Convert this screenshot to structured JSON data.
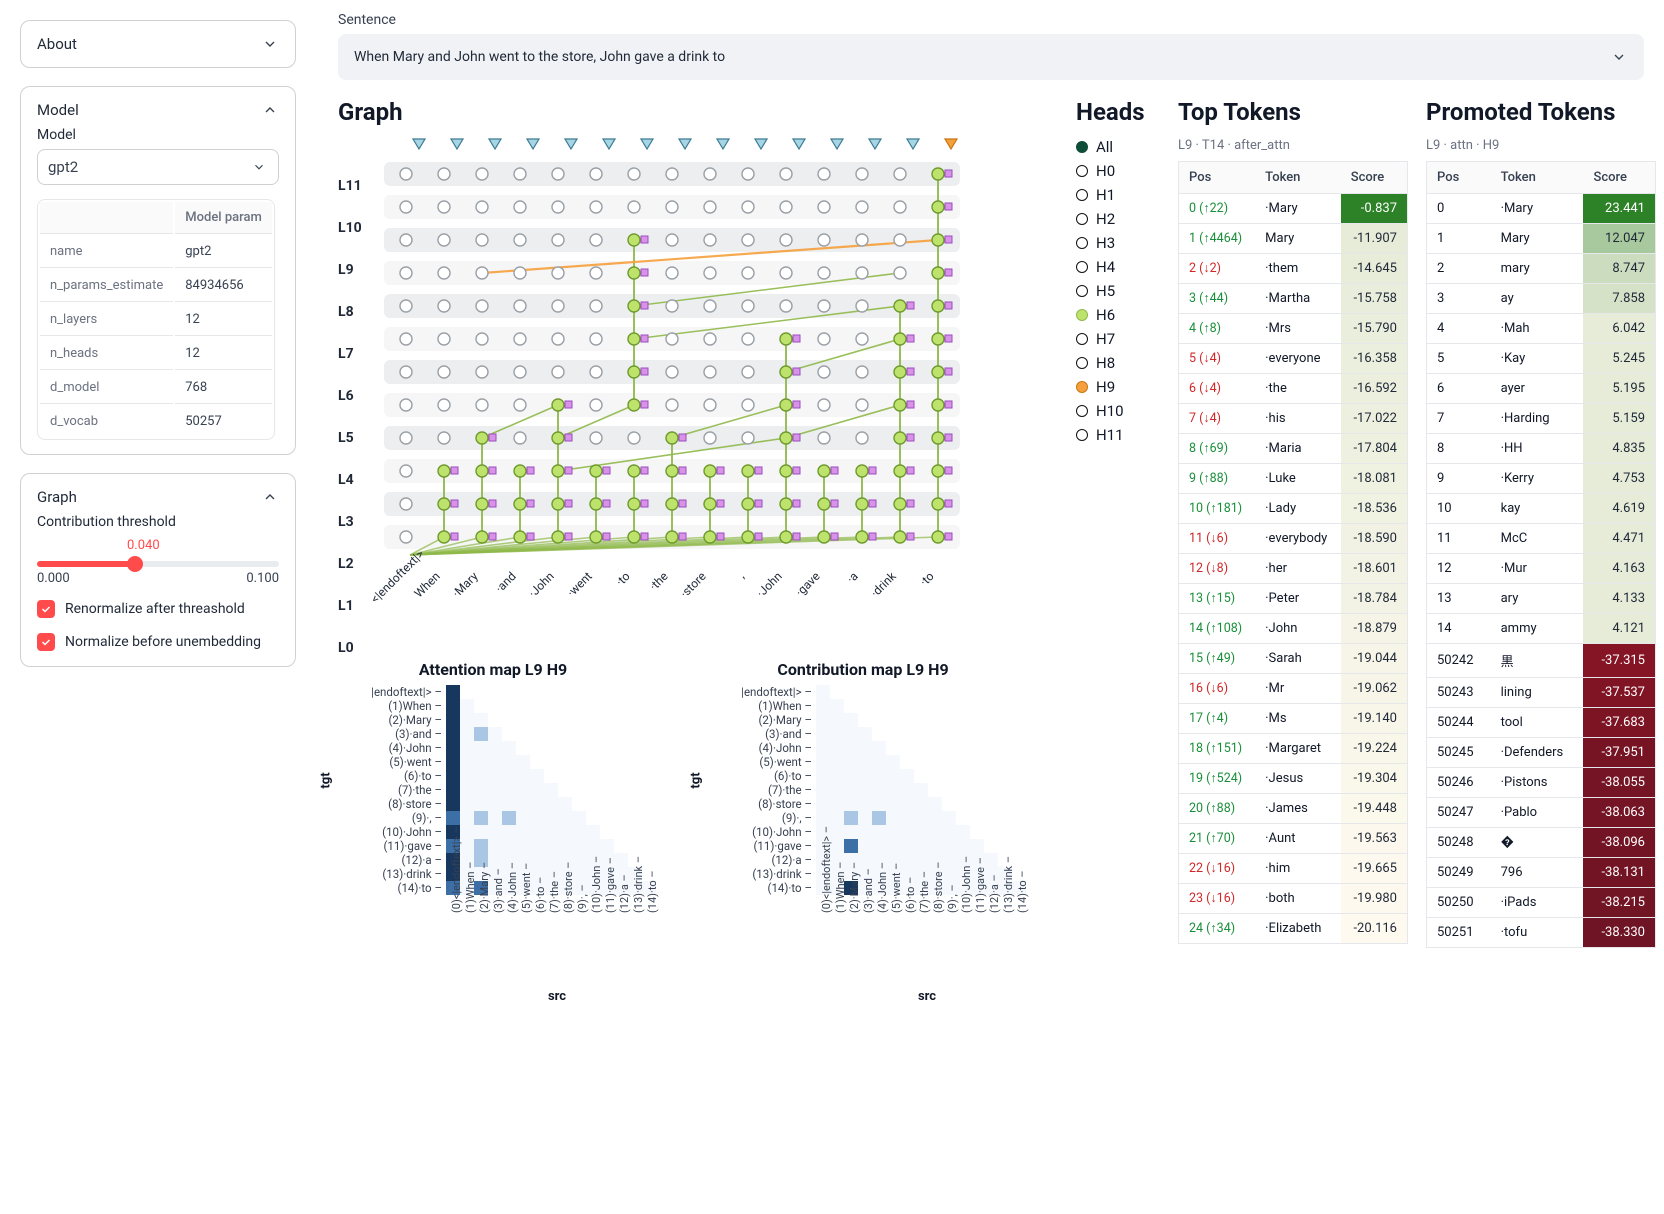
{
  "sidebar": {
    "about": {
      "title": "About",
      "expanded": false
    },
    "model_card": {
      "title": "Model",
      "label": "Model",
      "selected": "gpt2",
      "params_header_blank": "",
      "params_header_value": "Model param",
      "params": [
        {
          "name": "name",
          "value": "gpt2"
        },
        {
          "name": "n_params_estimate",
          "value": "84934656"
        },
        {
          "name": "n_layers",
          "value": "12"
        },
        {
          "name": "n_heads",
          "value": "12"
        },
        {
          "name": "d_model",
          "value": "768"
        },
        {
          "name": "d_vocab",
          "value": "50257"
        }
      ]
    },
    "graph_card": {
      "title": "Graph",
      "threshold_label": "Contribution threshold",
      "threshold_value": "0.040",
      "threshold_min": "0.000",
      "threshold_max": "0.100",
      "cb1": "Renormalize after threashold",
      "cb2": "Normalize before unembedding"
    }
  },
  "sentence": {
    "label": "Sentence",
    "text": "When Mary and John went to the store, John gave a drink to"
  },
  "graph": {
    "title": "Graph",
    "layers": [
      "L11",
      "L10",
      "L9",
      "L8",
      "L7",
      "L6",
      "L5",
      "L4",
      "L3",
      "L2",
      "L1",
      "L0"
    ],
    "tokens": [
      "<|endoftext|>",
      "When",
      "·Mary",
      "·and",
      "·John",
      "·went",
      "·to",
      "·the",
      "·store",
      ",",
      "·John",
      "·gave",
      "·a",
      "·drink",
      "·to"
    ]
  },
  "heads": {
    "title": "Heads",
    "items": [
      "All",
      "H0",
      "H1",
      "H2",
      "H3",
      "H4",
      "H5",
      "H6",
      "H7",
      "H8",
      "H9",
      "H10",
      "H11"
    ]
  },
  "top_tokens": {
    "title": "Top Tokens",
    "subtitle": "L9 · T14 · after_attn",
    "cols": {
      "pos": "Pos",
      "token": "Token",
      "score": "Score"
    },
    "rows": [
      {
        "pos": "0",
        "delta": "↑22",
        "dir": "up",
        "token": "·Mary",
        "score": "-0.837"
      },
      {
        "pos": "1",
        "delta": "↑4464",
        "dir": "up",
        "token": "Mary",
        "score": "-11.907"
      },
      {
        "pos": "2",
        "delta": "↓2",
        "dir": "dn",
        "token": "·them",
        "score": "-14.645"
      },
      {
        "pos": "3",
        "delta": "↑44",
        "dir": "up",
        "token": "·Martha",
        "score": "-15.758"
      },
      {
        "pos": "4",
        "delta": "↑8",
        "dir": "up",
        "token": "·Mrs",
        "score": "-15.790"
      },
      {
        "pos": "5",
        "delta": "↓4",
        "dir": "dn",
        "token": "·everyone",
        "score": "-16.358"
      },
      {
        "pos": "6",
        "delta": "↓4",
        "dir": "dn",
        "token": "·the",
        "score": "-16.592"
      },
      {
        "pos": "7",
        "delta": "↓4",
        "dir": "dn",
        "token": "·his",
        "score": "-17.022"
      },
      {
        "pos": "8",
        "delta": "↑69",
        "dir": "up",
        "token": "·Maria",
        "score": "-17.804"
      },
      {
        "pos": "9",
        "delta": "↑88",
        "dir": "up",
        "token": "·Luke",
        "score": "-18.081"
      },
      {
        "pos": "10",
        "delta": "↑181",
        "dir": "up",
        "token": "·Lady",
        "score": "-18.536"
      },
      {
        "pos": "11",
        "delta": "↓6",
        "dir": "dn",
        "token": "·everybody",
        "score": "-18.590"
      },
      {
        "pos": "12",
        "delta": "↓8",
        "dir": "dn",
        "token": "·her",
        "score": "-18.601"
      },
      {
        "pos": "13",
        "delta": "↑15",
        "dir": "up",
        "token": "·Peter",
        "score": "-18.784"
      },
      {
        "pos": "14",
        "delta": "↑108",
        "dir": "up",
        "token": "·John",
        "score": "-18.879"
      },
      {
        "pos": "15",
        "delta": "↑49",
        "dir": "up",
        "token": "·Sarah",
        "score": "-19.044"
      },
      {
        "pos": "16",
        "delta": "↓6",
        "dir": "dn",
        "token": "·Mr",
        "score": "-19.062"
      },
      {
        "pos": "17",
        "delta": "↑4",
        "dir": "up",
        "token": "·Ms",
        "score": "-19.140"
      },
      {
        "pos": "18",
        "delta": "↑151",
        "dir": "up",
        "token": "·Margaret",
        "score": "-19.224"
      },
      {
        "pos": "19",
        "delta": "↑524",
        "dir": "up",
        "token": "·Jesus",
        "score": "-19.304"
      },
      {
        "pos": "20",
        "delta": "↑88",
        "dir": "up",
        "token": "·James",
        "score": "-19.448"
      },
      {
        "pos": "21",
        "delta": "↑70",
        "dir": "up",
        "token": "·Aunt",
        "score": "-19.563"
      },
      {
        "pos": "22",
        "delta": "↓16",
        "dir": "dn",
        "token": "·him",
        "score": "-19.665"
      },
      {
        "pos": "23",
        "delta": "↓16",
        "dir": "dn",
        "token": "·both",
        "score": "-19.980"
      },
      {
        "pos": "24",
        "delta": "↑34",
        "dir": "up",
        "token": "·Elizabeth",
        "score": "-20.116"
      }
    ]
  },
  "promoted": {
    "title": "Promoted Tokens",
    "subtitle": "L9 · attn · H9",
    "cols": {
      "pos": "Pos",
      "token": "Token",
      "score": "Score"
    },
    "rows": [
      {
        "pos": "0",
        "token": "·Mary",
        "score": "23.441"
      },
      {
        "pos": "1",
        "token": "Mary",
        "score": "12.047"
      },
      {
        "pos": "2",
        "token": "mary",
        "score": "8.747"
      },
      {
        "pos": "3",
        "token": "ay",
        "score": "7.858"
      },
      {
        "pos": "4",
        "token": "·Mah",
        "score": "6.042"
      },
      {
        "pos": "5",
        "token": "·Kay",
        "score": "5.245"
      },
      {
        "pos": "6",
        "token": "ayer",
        "score": "5.195"
      },
      {
        "pos": "7",
        "token": "·Harding",
        "score": "5.159"
      },
      {
        "pos": "8",
        "token": "·HH",
        "score": "4.835"
      },
      {
        "pos": "9",
        "token": "·Kerry",
        "score": "4.753"
      },
      {
        "pos": "10",
        "token": "kay",
        "score": "4.619"
      },
      {
        "pos": "11",
        "token": "McC",
        "score": "4.471"
      },
      {
        "pos": "12",
        "token": "·Mur",
        "score": "4.163"
      },
      {
        "pos": "13",
        "token": "ary",
        "score": "4.133"
      },
      {
        "pos": "14",
        "token": "ammy",
        "score": "4.121"
      },
      {
        "pos": "50242",
        "token": "黒",
        "score": "-37.315"
      },
      {
        "pos": "50243",
        "token": "lining",
        "score": "-37.537"
      },
      {
        "pos": "50244",
        "token": "tool",
        "score": "-37.683"
      },
      {
        "pos": "50245",
        "token": "·Defenders",
        "score": "-37.951"
      },
      {
        "pos": "50246",
        "token": "·Pistons",
        "score": "-38.055"
      },
      {
        "pos": "50247",
        "token": "·Pablo",
        "score": "-38.063"
      },
      {
        "pos": "50248",
        "token": "�",
        "score": "-38.096"
      },
      {
        "pos": "50249",
        "token": "796",
        "score": "-38.131"
      },
      {
        "pos": "50250",
        "token": "·iPads",
        "score": "-38.215"
      },
      {
        "pos": "50251",
        "token": "·tofu",
        "score": "-38.330"
      }
    ]
  },
  "maps": {
    "attn_title": "Attention map L9 H9",
    "contrib_title": "Contribution map L9 H9",
    "y_axis": "tgt",
    "x_axis": "src",
    "y_labels": [
      "|endoftext|>",
      "(1)When",
      "(2)·Mary",
      "(3)·and",
      "(4)·John",
      "(5)·went",
      "(6)·to",
      "(7)·the",
      "(8)·store",
      "(9)·,",
      "(10)·John",
      "(11)·gave",
      "(12)·a",
      "(13)·drink",
      "(14)·to"
    ],
    "x_labels": [
      "(0)<|endoftext|>",
      "(1)When",
      "(2)·Mary",
      "(3)·and",
      "(4)·John",
      "(5)·went",
      "(6)·to",
      "(7)·the",
      "(8)·store",
      "(9)·,",
      "(10)·John",
      "(11)·gave",
      "(12)·a",
      "(13)·drink",
      "(14)·to"
    ]
  },
  "chart_data": {
    "graph": {
      "type": "node-link",
      "note": "12 layers x 15 token positions. Nodes lime-green indicate active residual stream positions; pink squares mark attention writes. Orange edge: L8 pos2 -> L9 pos14 (head H9). Green edges: active residual connections.",
      "layers": 12,
      "tokens": 15
    },
    "attention_map": {
      "type": "heatmap",
      "title": "Attention map L9 H9",
      "xlabel": "src",
      "ylabel": "tgt",
      "xlim": [
        0,
        14
      ],
      "ylim": [
        0,
        14
      ],
      "cells_approx": [
        {
          "tgt": 0,
          "src": 0,
          "v": 1.0
        },
        {
          "tgt": 1,
          "src": 0,
          "v": 1.0
        },
        {
          "tgt": 2,
          "src": 0,
          "v": 0.97
        },
        {
          "tgt": 3,
          "src": 0,
          "v": 0.85
        },
        {
          "tgt": 3,
          "src": 2,
          "v": 0.1
        },
        {
          "tgt": 4,
          "src": 0,
          "v": 0.95
        },
        {
          "tgt": 5,
          "src": 0,
          "v": 0.96
        },
        {
          "tgt": 6,
          "src": 0,
          "v": 0.97
        },
        {
          "tgt": 7,
          "src": 0,
          "v": 0.97
        },
        {
          "tgt": 8,
          "src": 0,
          "v": 0.97
        },
        {
          "tgt": 9,
          "src": 0,
          "v": 0.55
        },
        {
          "tgt": 9,
          "src": 2,
          "v": 0.2
        },
        {
          "tgt": 9,
          "src": 4,
          "v": 0.2
        },
        {
          "tgt": 10,
          "src": 0,
          "v": 0.95
        },
        {
          "tgt": 11,
          "src": 0,
          "v": 0.55
        },
        {
          "tgt": 11,
          "src": 2,
          "v": 0.4
        },
        {
          "tgt": 12,
          "src": 0,
          "v": 0.85
        },
        {
          "tgt": 12,
          "src": 2,
          "v": 0.08
        },
        {
          "tgt": 13,
          "src": 0,
          "v": 0.96
        },
        {
          "tgt": 14,
          "src": 0,
          "v": 0.5
        },
        {
          "tgt": 14,
          "src": 2,
          "v": 0.45
        }
      ]
    },
    "contribution_map": {
      "type": "heatmap",
      "title": "Contribution map L9 H9",
      "xlabel": "src",
      "ylabel": "tgt",
      "xlim": [
        0,
        14
      ],
      "ylim": [
        0,
        14
      ],
      "cells_approx": [
        {
          "tgt": 9,
          "src": 2,
          "v": 0.25
        },
        {
          "tgt": 9,
          "src": 4,
          "v": 0.25
        },
        {
          "tgt": 11,
          "src": 2,
          "v": 0.6
        },
        {
          "tgt": 14,
          "src": 2,
          "v": 0.95
        }
      ]
    }
  }
}
